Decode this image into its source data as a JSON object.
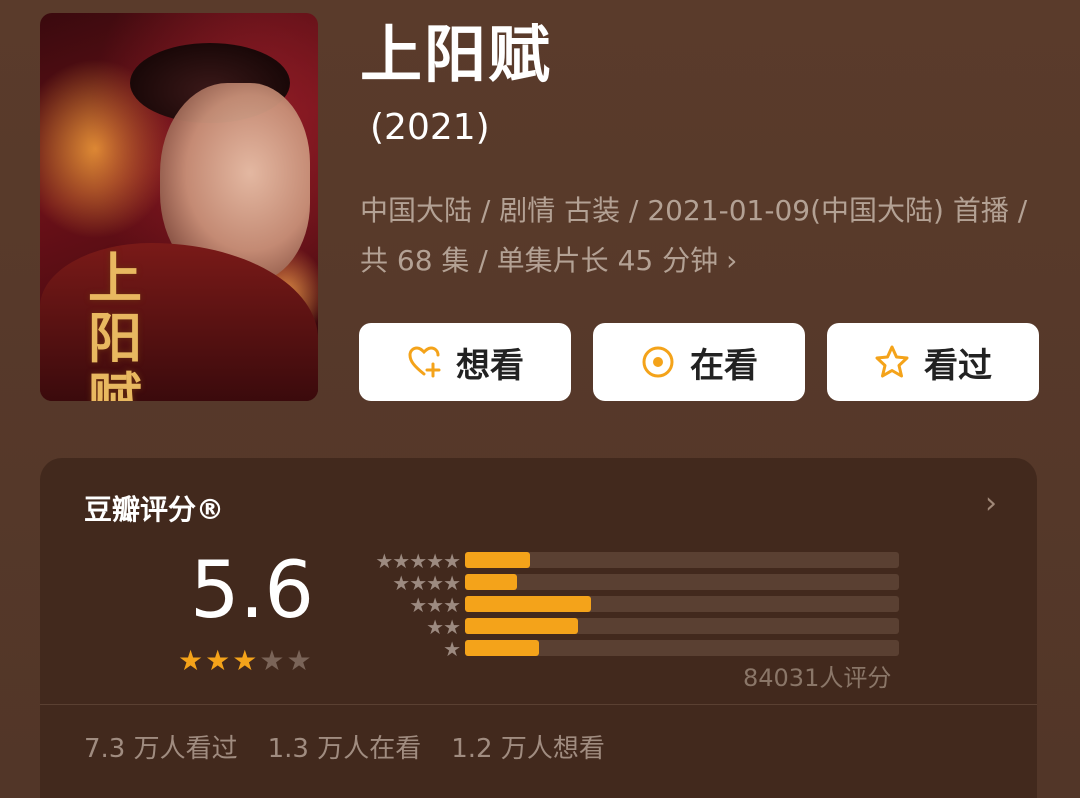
{
  "poster": {
    "title_art": "上阳赋"
  },
  "title": "上阳赋",
  "year": "(2021)",
  "meta": "中国大陆 / 剧情 古装 / 2021-01-09(中国大陆) 首播 / 共 68 集 / 单集片长 45 分钟",
  "buttons": {
    "want": "想看",
    "watching": "在看",
    "watched": "看过"
  },
  "rating": {
    "header": "豆瓣评分®",
    "score": "5.6",
    "stars_filled": 3,
    "stars_total": 5,
    "distribution": [
      {
        "stars": "★★★★★",
        "fraction": 0.15
      },
      {
        "stars": "★★★★",
        "fraction": 0.12
      },
      {
        "stars": "★★★",
        "fraction": 0.29
      },
      {
        "stars": "★★",
        "fraction": 0.26
      },
      {
        "stars": "★",
        "fraction": 0.17
      }
    ],
    "count": "84031人评分",
    "stats": [
      "7.3 万人看过",
      "1.3 万人在看",
      "1.2 万人想看"
    ]
  },
  "colors": {
    "accent": "#f4a31a",
    "background": "#55392a",
    "card": "#42291d"
  }
}
